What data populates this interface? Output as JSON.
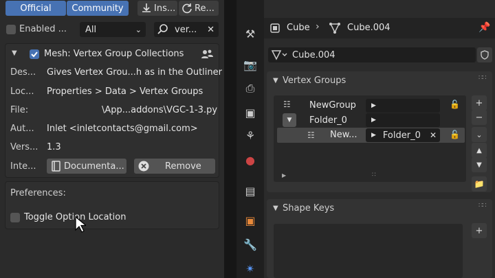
{
  "addon": {
    "tabs": {
      "official": "Official",
      "community": "Community"
    },
    "install_label": "Ins...",
    "refresh_label": "Re...",
    "filter": {
      "enabled_label": "Enabled ...",
      "category_value": "All",
      "search_value": "ver..."
    },
    "title": "Mesh: Vertex Group Collections",
    "rows": {
      "description": {
        "label": "Des...",
        "value": "Gives Vertex Grou...h as in the Outliner"
      },
      "location": {
        "label": "Loc...",
        "value": "Properties > Data > Vertex Groups"
      },
      "file": {
        "label": "File:",
        "value": "\\App...addons\\VGC-1-3.py"
      },
      "author": {
        "label": "Aut...",
        "value": "Inlet <inletcontacts@gmail.com>"
      },
      "version": {
        "label": "Vers...",
        "value": "1.3"
      },
      "internet": {
        "label": "Inte..."
      }
    },
    "documentation_label": "Documenta...",
    "remove_label": "Remove",
    "preferences": {
      "title": "Preferences:",
      "toggle_label": "Toggle Option Location"
    }
  },
  "properties": {
    "breadcrumb": {
      "object": "Cube",
      "data": "Cube.004"
    },
    "mesh_name": "Cube.004",
    "vertex_groups": {
      "title": "Vertex Groups",
      "items": [
        {
          "name": "NewGroup",
          "field": ""
        },
        {
          "name": "Folder_0",
          "field": ""
        },
        {
          "name": "New...",
          "field": "Folder_0"
        }
      ]
    },
    "shape_keys": {
      "title": "Shape Keys"
    }
  },
  "colors": {
    "accent": "#4772b3",
    "panel": "#2b2b2b",
    "header": "#1d1d1d"
  }
}
